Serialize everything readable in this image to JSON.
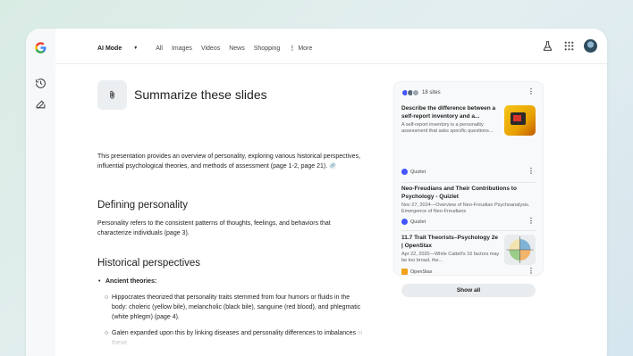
{
  "header": {
    "nav": {
      "mode": "AI Mode",
      "items": [
        "All",
        "Images",
        "Videos",
        "News",
        "Shopping"
      ],
      "more": "More"
    }
  },
  "query": {
    "title": "Summarize these slides"
  },
  "answer": {
    "intro": "This presentation provides an overview of personality, exploring various historical perspectives, influential psychological theories, and methods of assessment (page 1-2, page 21).",
    "section1_heading": "Defining personality",
    "section1_text": "Personality refers to the consistent patterns of thoughts, feelings, and behaviors that characterize individuals (page 3).",
    "section2_heading": "Historical perspectives",
    "bullet_title": "Ancient theories:",
    "sub1": "Hippocrates theorized that personality traits stemmed from four humors or fluids in the body: choleric (yellow bile), melancholic (black bile), sanguine (red blood), and phlegmatic (white phlegm) (page 4).",
    "sub2_main": "Galen expanded upon this by linking diseases and personality differences to imbalances ",
    "sub2_fade": "in these"
  },
  "sources": {
    "count": "18 sites",
    "items": [
      {
        "title": "Describe the difference between a self-report inventory and a...",
        "snippet": "A self-report inventory is a personality assessment that asks specific questions...",
        "site": "Quizlet"
      },
      {
        "title": "Neo-Freudians and Their Contributions to Psychology - Quizlet",
        "snippet": "Nov 27, 2024—Overview of Neo-Freudian Psychoanalysis. Emergence of Neo-Freudians",
        "site": "Quizlet"
      },
      {
        "title": "11.7 Trait Theorists–Psychology 2e | OpenStax",
        "snippet": "Apr 22, 2020—While Cattell's 16 factors may be too broad, the...",
        "site": "OpenStax"
      }
    ],
    "show_all": "Show all"
  },
  "colors": {
    "accent_blue": "#4285f4",
    "quizlet": "#4255ff",
    "openstax": "#f3a21d"
  }
}
